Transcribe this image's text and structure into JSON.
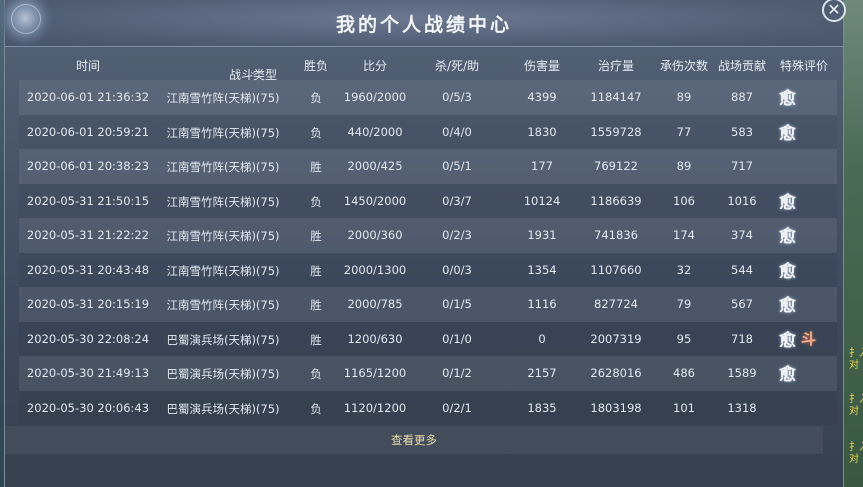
{
  "window": {
    "title": "我的个人战绩中心",
    "close_icon": "close-icon"
  },
  "headers": {
    "time": "时间",
    "battle_type": "战斗类型",
    "result": "胜负",
    "score": "比分",
    "kda": "杀/死/助",
    "damage": "伤害量",
    "healing": "治疗量",
    "damage_taken": "承伤次数",
    "contribution": "战场贡献",
    "special": "特殊评价"
  },
  "rows": [
    {
      "time": "2020-06-01 21:36:32",
      "type": "江南雪竹阵(天梯)(75)",
      "result": "负",
      "score": "1960/2000",
      "kda": "0/5/3",
      "damage": "4399",
      "healing": "1184147",
      "taken": "89",
      "contrib": "887",
      "badge": "愈",
      "badge2": ""
    },
    {
      "time": "2020-06-01 20:59:21",
      "type": "江南雪竹阵(天梯)(75)",
      "result": "负",
      "score": "440/2000",
      "kda": "0/4/0",
      "damage": "1830",
      "healing": "1559728",
      "taken": "77",
      "contrib": "583",
      "badge": "愈",
      "badge2": ""
    },
    {
      "time": "2020-06-01 20:38:23",
      "type": "江南雪竹阵(天梯)(75)",
      "result": "胜",
      "score": "2000/425",
      "kda": "0/5/1",
      "damage": "177",
      "healing": "769122",
      "taken": "89",
      "contrib": "717",
      "badge": "",
      "badge2": ""
    },
    {
      "time": "2020-05-31 21:50:15",
      "type": "江南雪竹阵(天梯)(75)",
      "result": "负",
      "score": "1450/2000",
      "kda": "0/3/7",
      "damage": "10124",
      "healing": "1186639",
      "taken": "106",
      "contrib": "1016",
      "badge": "愈",
      "badge2": ""
    },
    {
      "time": "2020-05-31 21:22:22",
      "type": "江南雪竹阵(天梯)(75)",
      "result": "胜",
      "score": "2000/360",
      "kda": "0/2/3",
      "damage": "1931",
      "healing": "741836",
      "taken": "174",
      "contrib": "374",
      "badge": "愈",
      "badge2": ""
    },
    {
      "time": "2020-05-31 20:43:48",
      "type": "江南雪竹阵(天梯)(75)",
      "result": "胜",
      "score": "2000/1300",
      "kda": "0/0/3",
      "damage": "1354",
      "healing": "1107660",
      "taken": "32",
      "contrib": "544",
      "badge": "愈",
      "badge2": ""
    },
    {
      "time": "2020-05-31 20:15:19",
      "type": "江南雪竹阵(天梯)(75)",
      "result": "胜",
      "score": "2000/785",
      "kda": "0/1/5",
      "damage": "1116",
      "healing": "827724",
      "taken": "79",
      "contrib": "567",
      "badge": "愈",
      "badge2": ""
    },
    {
      "time": "2020-05-30 22:08:24",
      "type": "巴蜀演兵场(天梯)(75)",
      "result": "胜",
      "score": "1200/630",
      "kda": "0/1/0",
      "damage": "0",
      "healing": "2007319",
      "taken": "95",
      "contrib": "718",
      "badge": "愈",
      "badge2": "斗"
    },
    {
      "time": "2020-05-30 21:49:13",
      "type": "巴蜀演兵场(天梯)(75)",
      "result": "负",
      "score": "1165/1200",
      "kda": "0/1/2",
      "damage": "2157",
      "healing": "2628016",
      "taken": "486",
      "contrib": "1589",
      "badge": "愈",
      "badge2": ""
    },
    {
      "time": "2020-05-30 20:06:43",
      "type": "巴蜀演兵场(天梯)(75)",
      "result": "负",
      "score": "1120/1200",
      "kda": "0/2/1",
      "damage": "1835",
      "healing": "1803198",
      "taken": "101",
      "contrib": "1318",
      "badge": "",
      "badge2": ""
    }
  ],
  "footer": {
    "more_label": "查看更多"
  },
  "side_text": [
    "扌入\n对",
    "扌入\n对",
    "扌入\n对"
  ],
  "colors": {
    "accent": "#e8d9a8",
    "text": "#e3e8f0",
    "panel": "#3e4a5e"
  }
}
